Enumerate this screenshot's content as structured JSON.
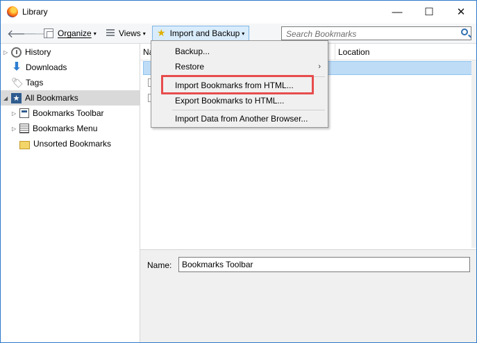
{
  "window": {
    "title": "Library",
    "minimize": "—",
    "maximize": "☐",
    "close": "✕"
  },
  "toolbar": {
    "back": "🡐",
    "forward": "🡒",
    "organize_label": "Organize",
    "views_label": "Views",
    "import_backup_label": "Import and Backup",
    "caret": "▾"
  },
  "search": {
    "placeholder": "Search Bookmarks",
    "value": ""
  },
  "sidebar": {
    "items": [
      {
        "label": "History",
        "icon": "clock-icon"
      },
      {
        "label": "Downloads",
        "icon": "download-icon"
      },
      {
        "label": "Tags",
        "icon": "tag-icon"
      },
      {
        "label": "All Bookmarks",
        "icon": "star-square-icon",
        "selected": true
      },
      {
        "label": "Bookmarks Toolbar",
        "icon": "toolbar-icon"
      },
      {
        "label": "Bookmarks Menu",
        "icon": "list-icon"
      },
      {
        "label": "Unsorted Bookmarks",
        "icon": "unsorted-icon"
      }
    ],
    "twisty": "▷"
  },
  "content": {
    "columns": [
      "Na",
      "Location"
    ]
  },
  "menu": {
    "items": [
      {
        "label": "Backup..."
      },
      {
        "label": "Restore",
        "submenu": "›"
      },
      {
        "label": "Import Bookmarks from HTML..."
      },
      {
        "label": "Export Bookmarks to HTML..."
      },
      {
        "label": "Import Data from Another Browser..."
      }
    ]
  },
  "details": {
    "name_label": "Name:",
    "name_value": "Bookmarks Toolbar"
  },
  "colors": {
    "accent": "#2b78c9",
    "highlight": "#e74c4c",
    "selection": "#bfdcf7"
  }
}
